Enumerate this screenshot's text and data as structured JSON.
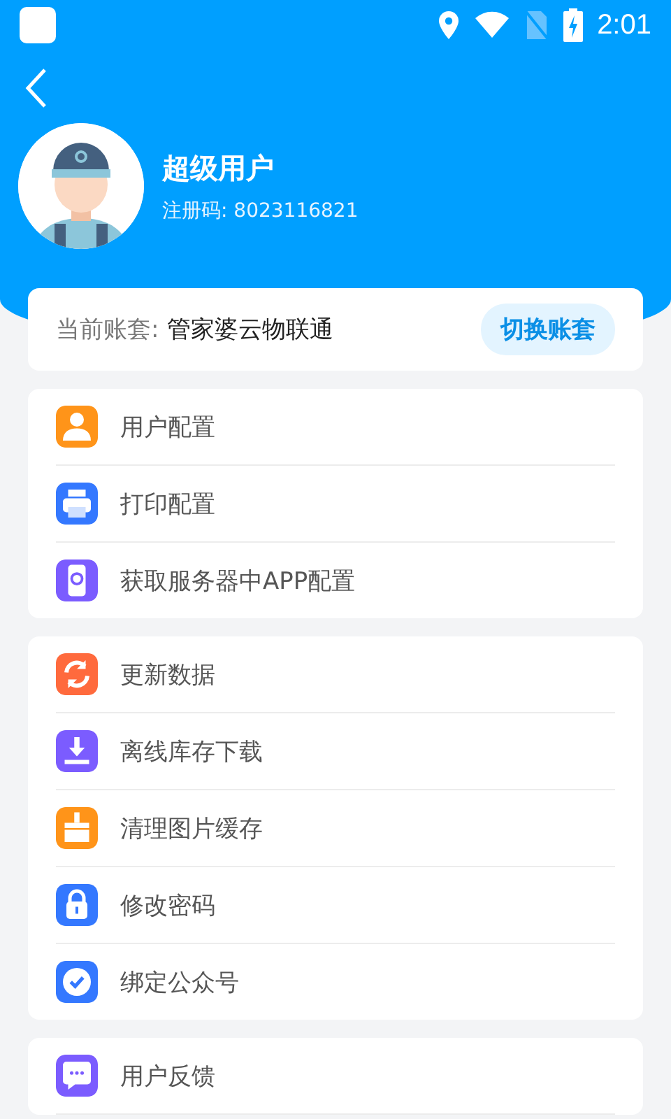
{
  "status_bar": {
    "time": "2:01"
  },
  "profile": {
    "name": "超级用户",
    "reg_label": "注册码: 8023116821"
  },
  "account": {
    "label": "当前账套:",
    "value": "管家婆云物联通",
    "switch_button": "切换账套"
  },
  "groups": [
    {
      "items": [
        {
          "label": "用户配置",
          "kind": "user",
          "color": "#ff9419"
        },
        {
          "label": "打印配置",
          "kind": "printer",
          "color": "#3478ff"
        },
        {
          "label": "获取服务器中APP配置",
          "kind": "phone",
          "color": "#7b5cff"
        }
      ]
    },
    {
      "items": [
        {
          "label": "更新数据",
          "kind": "refresh",
          "color": "#ff6a3d"
        },
        {
          "label": "离线库存下载",
          "kind": "download",
          "color": "#7b5cff"
        },
        {
          "label": "清理图片缓存",
          "kind": "brush",
          "color": "#ff9419"
        },
        {
          "label": "修改密码",
          "kind": "lock",
          "color": "#3478ff"
        },
        {
          "label": "绑定公众号",
          "kind": "badge",
          "color": "#3478ff"
        }
      ]
    },
    {
      "items": [
        {
          "label": "用户反馈",
          "kind": "chat",
          "color": "#7b5cff"
        }
      ]
    }
  ]
}
